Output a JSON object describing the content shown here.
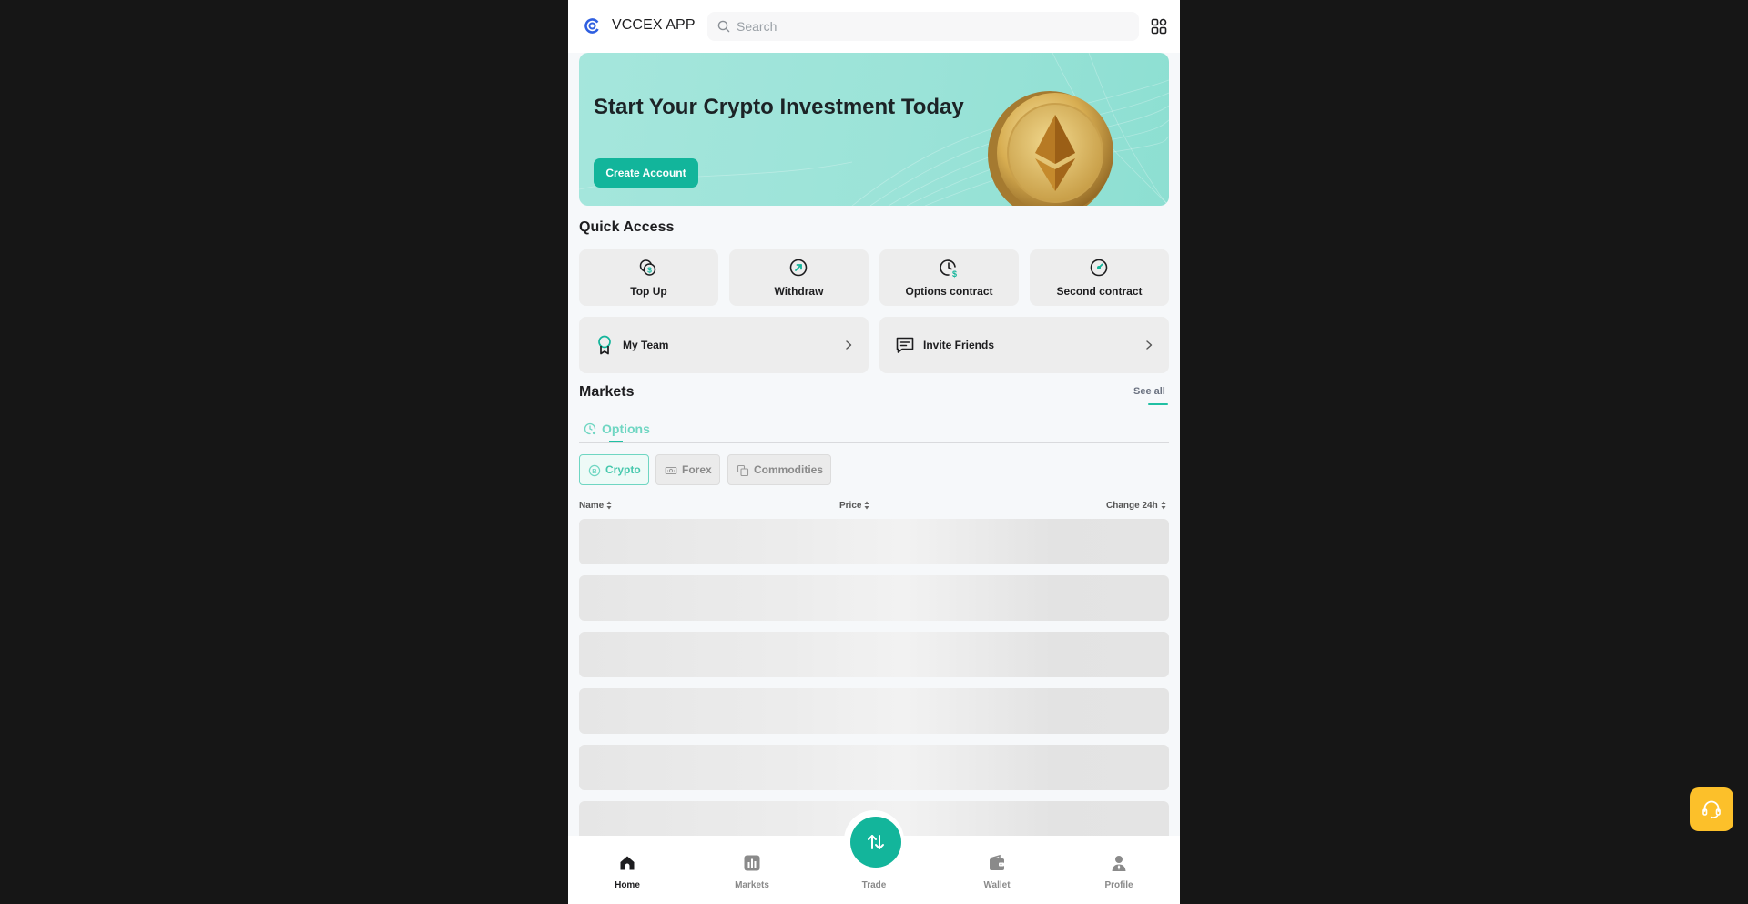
{
  "header": {
    "app_title": "VCCEX APP",
    "search_placeholder": "Search",
    "search_value": ""
  },
  "banner": {
    "title": "Start Your Crypto Investment Today",
    "cta_label": "Create Account"
  },
  "quick_access": {
    "title": "Quick Access",
    "items": [
      {
        "label": "Top Up",
        "icon": "coin-dollar-icon"
      },
      {
        "label": "Withdraw",
        "icon": "arrow-up-right-circle-icon"
      },
      {
        "label": "Options contract",
        "icon": "clock-dollar-icon"
      },
      {
        "label": "Second contract",
        "icon": "gauge-icon"
      }
    ],
    "wide_items": [
      {
        "label": "My Team",
        "icon": "ribbon-badge-icon"
      },
      {
        "label": "Invite Friends",
        "icon": "chat-message-icon"
      }
    ]
  },
  "markets": {
    "title": "Markets",
    "see_all": "See all",
    "tab": {
      "label": "Options",
      "icon": "clock-icon"
    },
    "chips": [
      {
        "label": "Crypto",
        "icon": "bitcoin-icon",
        "active": true
      },
      {
        "label": "Forex",
        "icon": "banknote-icon",
        "active": false
      },
      {
        "label": "Commodities",
        "icon": "stack-icon",
        "active": false
      }
    ],
    "columns": [
      "Name",
      "Price",
      "Change 24h"
    ],
    "rows_loading": 6
  },
  "bottom_nav": {
    "items": [
      {
        "label": "Home",
        "icon": "home-icon",
        "active": true
      },
      {
        "label": "Markets",
        "icon": "bar-chart-icon",
        "active": false
      },
      {
        "label": "Trade",
        "icon": "swap-arrows-icon",
        "active": false
      },
      {
        "label": "Wallet",
        "icon": "wallet-icon",
        "active": false
      },
      {
        "label": "Profile",
        "icon": "user-icon",
        "active": false
      }
    ]
  },
  "colors": {
    "accent": "#13b59b",
    "accent_light": "#6fd6c2",
    "banner_bg": "#9be3d8",
    "support": "#fcc02a",
    "outer_bg": "#161616"
  }
}
